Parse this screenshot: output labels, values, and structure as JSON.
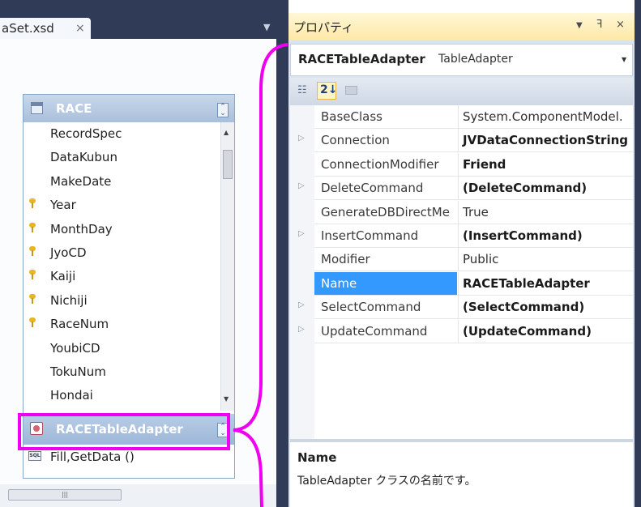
{
  "document_tab": {
    "label": "aSet.xsd",
    "close": "×"
  },
  "table": {
    "title": "RACE",
    "columns": [
      {
        "name": "RecordSpec",
        "key": false
      },
      {
        "name": "DataKubun",
        "key": false
      },
      {
        "name": "MakeDate",
        "key": false
      },
      {
        "name": "Year",
        "key": true
      },
      {
        "name": "MonthDay",
        "key": true
      },
      {
        "name": "JyoCD",
        "key": true
      },
      {
        "name": "Kaiji",
        "key": true
      },
      {
        "name": "Nichiji",
        "key": true
      },
      {
        "name": "RaceNum",
        "key": true
      },
      {
        "name": "YoubiCD",
        "key": false
      },
      {
        "name": "TokuNum",
        "key": false
      },
      {
        "name": "Hondai",
        "key": false
      }
    ]
  },
  "adapter": {
    "title": "RACETableAdapter",
    "method": "Fill,GetData ()",
    "method_icon": "SQL"
  },
  "properties_panel": {
    "title": "プロパティ",
    "pin": "ꟻ",
    "close": "×",
    "object_name": "RACETableAdapter",
    "object_type": "TableAdapter",
    "rows": [
      {
        "name": "BaseClass",
        "value": "System.ComponentModel.",
        "bold": false,
        "expandable": false,
        "selected": false
      },
      {
        "name": "Connection",
        "value": "JVDataConnectionString",
        "bold": true,
        "expandable": true,
        "selected": false
      },
      {
        "name": "ConnectionModifier",
        "value": "Friend",
        "bold": true,
        "expandable": false,
        "selected": false
      },
      {
        "name": "DeleteCommand",
        "value": "(DeleteCommand)",
        "bold": true,
        "expandable": true,
        "selected": false
      },
      {
        "name": "GenerateDBDirectMe",
        "value": "True",
        "bold": false,
        "expandable": false,
        "selected": false
      },
      {
        "name": "InsertCommand",
        "value": "(InsertCommand)",
        "bold": true,
        "expandable": true,
        "selected": false
      },
      {
        "name": "Modifier",
        "value": "Public",
        "bold": false,
        "expandable": false,
        "selected": false
      },
      {
        "name": "Name",
        "value": "RACETableAdapter",
        "bold": true,
        "expandable": false,
        "selected": true
      },
      {
        "name": "SelectCommand",
        "value": "(SelectCommand)",
        "bold": true,
        "expandable": true,
        "selected": false
      },
      {
        "name": "UpdateCommand",
        "value": "(UpdateCommand)",
        "bold": true,
        "expandable": true,
        "selected": false
      }
    ],
    "description_title": "Name",
    "description_text": "TableAdapter クラスの名前です。"
  },
  "colors": {
    "highlight": "#f000f0",
    "selection": "#3399ff",
    "chrome": "#2f3b57"
  }
}
